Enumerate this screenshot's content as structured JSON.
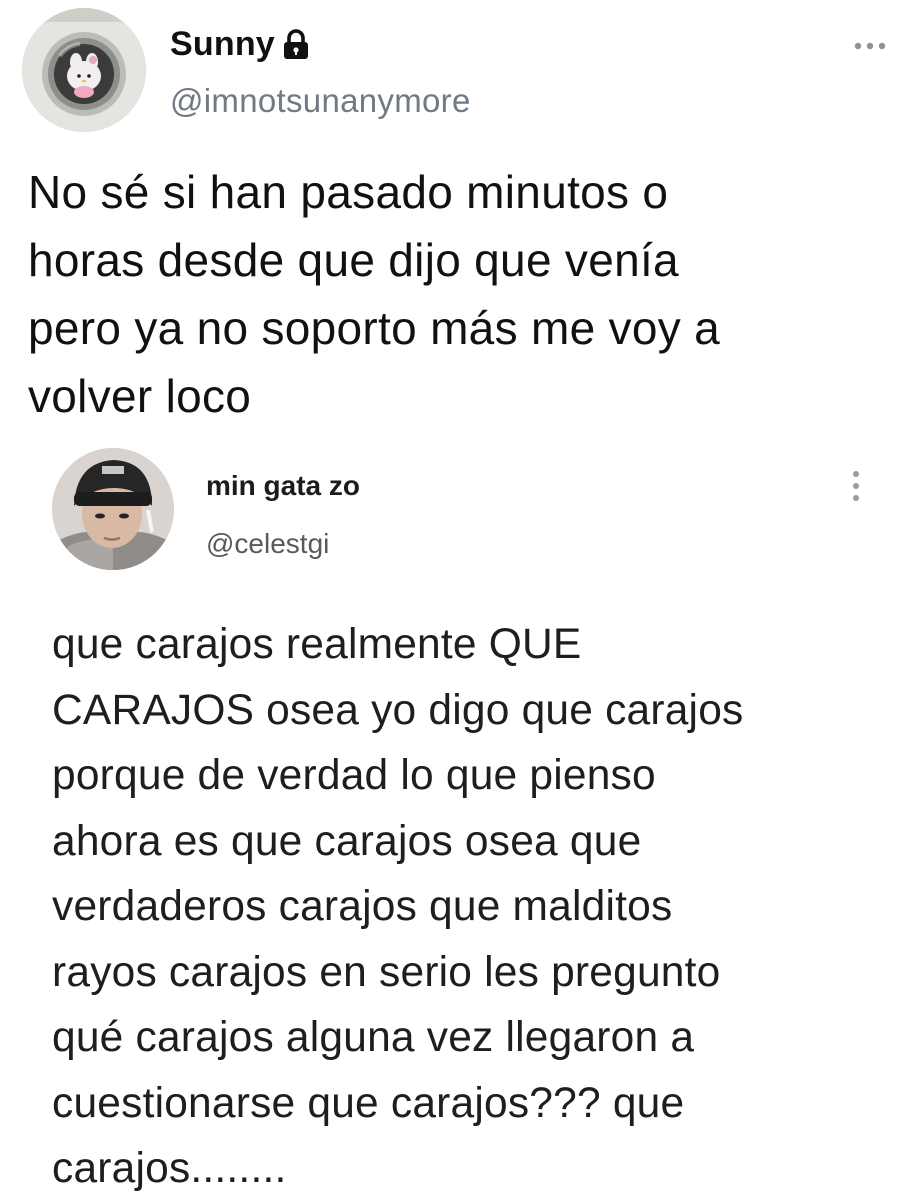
{
  "tweet": {
    "author": {
      "display_name": "Sunny",
      "handle": "@imnotsunanymore",
      "protected_icon": "lock-icon",
      "avatar": "avatar-washing-machine-plush"
    },
    "menu_icon": "more-horizontal-icon",
    "text": "No sé si han pasado minutos o\nhoras desde que dijo que venía\npero ya no soporto más me voy a\nvolver loco"
  },
  "quoted": {
    "author": {
      "display_name": "min gata zo",
      "handle": "@celestgi",
      "avatar": "avatar-person-beanie"
    },
    "menu_icon": "more-vertical-icon",
    "text": "que carajos realmente QUE\nCARAJOS osea yo digo que carajos\nporque de verdad lo que pienso\nahora es que carajos osea que\nverdaderos carajos que malditos\nrayos carajos en serio les pregunto\nqué carajos alguna vez llegaron a\ncuestionarse que carajos??? que\ncarajos........"
  },
  "colors": {
    "text": "#111111",
    "handle": "#6f7a85",
    "quoted_handle": "#5a5a5a",
    "icon": "#8a939c"
  }
}
